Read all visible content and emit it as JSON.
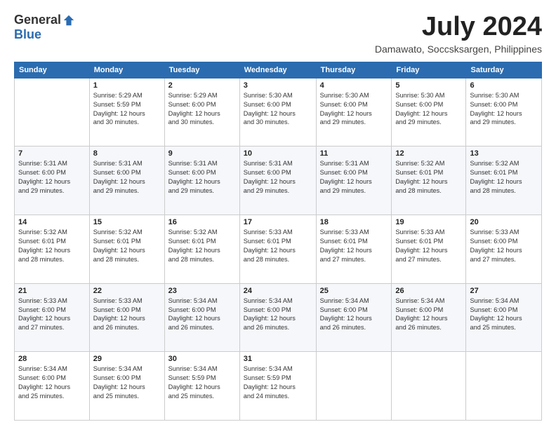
{
  "logo": {
    "general": "General",
    "blue": "Blue"
  },
  "title": "July 2024",
  "subtitle": "Damawato, Soccsksargen, Philippines",
  "headers": [
    "Sunday",
    "Monday",
    "Tuesday",
    "Wednesday",
    "Thursday",
    "Friday",
    "Saturday"
  ],
  "weeks": [
    [
      {
        "num": "",
        "info": ""
      },
      {
        "num": "1",
        "info": "Sunrise: 5:29 AM\nSunset: 5:59 PM\nDaylight: 12 hours\nand 30 minutes."
      },
      {
        "num": "2",
        "info": "Sunrise: 5:29 AM\nSunset: 6:00 PM\nDaylight: 12 hours\nand 30 minutes."
      },
      {
        "num": "3",
        "info": "Sunrise: 5:30 AM\nSunset: 6:00 PM\nDaylight: 12 hours\nand 30 minutes."
      },
      {
        "num": "4",
        "info": "Sunrise: 5:30 AM\nSunset: 6:00 PM\nDaylight: 12 hours\nand 29 minutes."
      },
      {
        "num": "5",
        "info": "Sunrise: 5:30 AM\nSunset: 6:00 PM\nDaylight: 12 hours\nand 29 minutes."
      },
      {
        "num": "6",
        "info": "Sunrise: 5:30 AM\nSunset: 6:00 PM\nDaylight: 12 hours\nand 29 minutes."
      }
    ],
    [
      {
        "num": "7",
        "info": "Sunrise: 5:31 AM\nSunset: 6:00 PM\nDaylight: 12 hours\nand 29 minutes."
      },
      {
        "num": "8",
        "info": "Sunrise: 5:31 AM\nSunset: 6:00 PM\nDaylight: 12 hours\nand 29 minutes."
      },
      {
        "num": "9",
        "info": "Sunrise: 5:31 AM\nSunset: 6:00 PM\nDaylight: 12 hours\nand 29 minutes."
      },
      {
        "num": "10",
        "info": "Sunrise: 5:31 AM\nSunset: 6:00 PM\nDaylight: 12 hours\nand 29 minutes."
      },
      {
        "num": "11",
        "info": "Sunrise: 5:31 AM\nSunset: 6:00 PM\nDaylight: 12 hours\nand 29 minutes."
      },
      {
        "num": "12",
        "info": "Sunrise: 5:32 AM\nSunset: 6:01 PM\nDaylight: 12 hours\nand 28 minutes."
      },
      {
        "num": "13",
        "info": "Sunrise: 5:32 AM\nSunset: 6:01 PM\nDaylight: 12 hours\nand 28 minutes."
      }
    ],
    [
      {
        "num": "14",
        "info": "Sunrise: 5:32 AM\nSunset: 6:01 PM\nDaylight: 12 hours\nand 28 minutes."
      },
      {
        "num": "15",
        "info": "Sunrise: 5:32 AM\nSunset: 6:01 PM\nDaylight: 12 hours\nand 28 minutes."
      },
      {
        "num": "16",
        "info": "Sunrise: 5:32 AM\nSunset: 6:01 PM\nDaylight: 12 hours\nand 28 minutes."
      },
      {
        "num": "17",
        "info": "Sunrise: 5:33 AM\nSunset: 6:01 PM\nDaylight: 12 hours\nand 28 minutes."
      },
      {
        "num": "18",
        "info": "Sunrise: 5:33 AM\nSunset: 6:01 PM\nDaylight: 12 hours\nand 27 minutes."
      },
      {
        "num": "19",
        "info": "Sunrise: 5:33 AM\nSunset: 6:01 PM\nDaylight: 12 hours\nand 27 minutes."
      },
      {
        "num": "20",
        "info": "Sunrise: 5:33 AM\nSunset: 6:00 PM\nDaylight: 12 hours\nand 27 minutes."
      }
    ],
    [
      {
        "num": "21",
        "info": "Sunrise: 5:33 AM\nSunset: 6:00 PM\nDaylight: 12 hours\nand 27 minutes."
      },
      {
        "num": "22",
        "info": "Sunrise: 5:33 AM\nSunset: 6:00 PM\nDaylight: 12 hours\nand 26 minutes."
      },
      {
        "num": "23",
        "info": "Sunrise: 5:34 AM\nSunset: 6:00 PM\nDaylight: 12 hours\nand 26 minutes."
      },
      {
        "num": "24",
        "info": "Sunrise: 5:34 AM\nSunset: 6:00 PM\nDaylight: 12 hours\nand 26 minutes."
      },
      {
        "num": "25",
        "info": "Sunrise: 5:34 AM\nSunset: 6:00 PM\nDaylight: 12 hours\nand 26 minutes."
      },
      {
        "num": "26",
        "info": "Sunrise: 5:34 AM\nSunset: 6:00 PM\nDaylight: 12 hours\nand 26 minutes."
      },
      {
        "num": "27",
        "info": "Sunrise: 5:34 AM\nSunset: 6:00 PM\nDaylight: 12 hours\nand 25 minutes."
      }
    ],
    [
      {
        "num": "28",
        "info": "Sunrise: 5:34 AM\nSunset: 6:00 PM\nDaylight: 12 hours\nand 25 minutes."
      },
      {
        "num": "29",
        "info": "Sunrise: 5:34 AM\nSunset: 6:00 PM\nDaylight: 12 hours\nand 25 minutes."
      },
      {
        "num": "30",
        "info": "Sunrise: 5:34 AM\nSunset: 5:59 PM\nDaylight: 12 hours\nand 25 minutes."
      },
      {
        "num": "31",
        "info": "Sunrise: 5:34 AM\nSunset: 5:59 PM\nDaylight: 12 hours\nand 24 minutes."
      },
      {
        "num": "",
        "info": ""
      },
      {
        "num": "",
        "info": ""
      },
      {
        "num": "",
        "info": ""
      }
    ]
  ]
}
